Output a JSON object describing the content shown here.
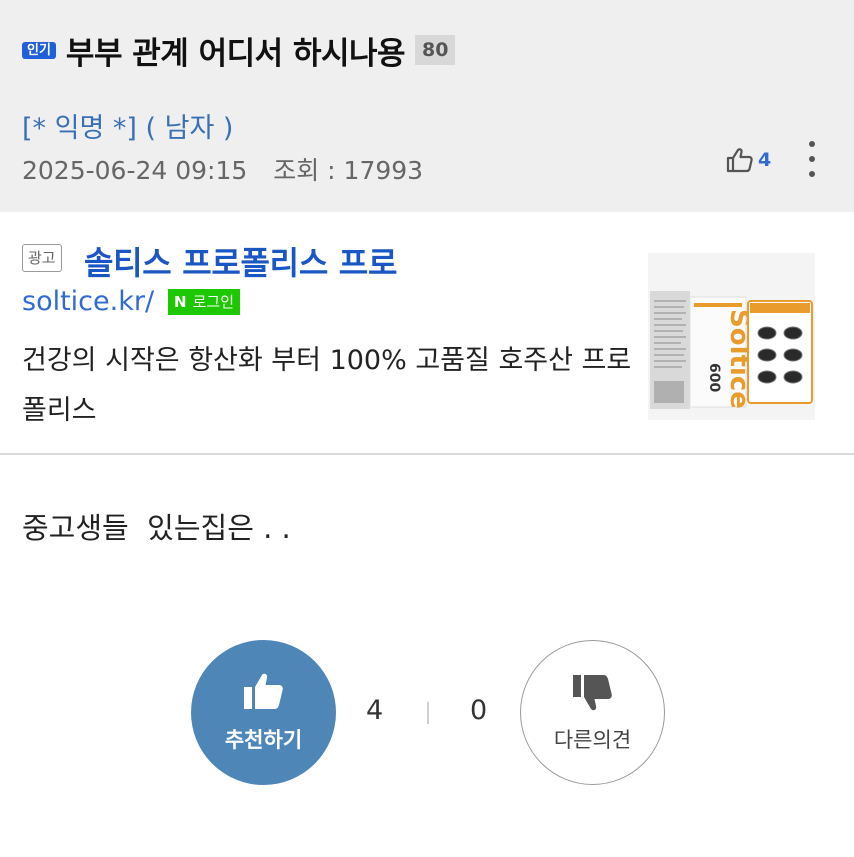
{
  "post": {
    "badge": "인기",
    "title": "부부 관계 어디서 하시나용",
    "comment_count": "80",
    "author": "[* 익명 *] ( 남자 )",
    "datetime": "2025-06-24 09:15",
    "views_label": "조회 : 17993",
    "like_count": "4",
    "body": "중고생들  있는집은 . ."
  },
  "ad": {
    "label": "광고",
    "headline": "솔티스 프로폴리스 프로",
    "url": "soltice.kr/",
    "login_mark": "N",
    "login_label": "로그인",
    "description": "건강의 시작은 항산화 부터 100% 고품질 호주산 프로폴리스",
    "image_brand_text": "Soltice",
    "image_dose_text": "600"
  },
  "vote": {
    "recommend_label": "추천하기",
    "recommend_count": "4",
    "oppose_label": "다른의견",
    "oppose_count": "0"
  },
  "colors": {
    "badge_blue": "#1f5fd9",
    "recommend_blue": "#4e86b8",
    "naver_green": "#1ec800",
    "link_blue": "#1a56c4",
    "header_bg": "#efefef",
    "product_orange": "#e99b2c"
  },
  "icons": {
    "like": "thumbs-up-outline-icon",
    "menu": "more-vertical-icon",
    "recommend": "thumbs-up-icon",
    "oppose": "thumbs-down-icon"
  }
}
